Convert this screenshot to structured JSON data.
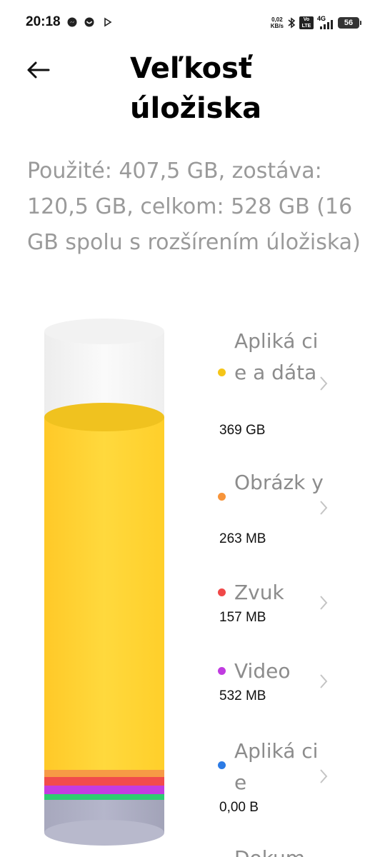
{
  "status_bar": {
    "time": "20:18",
    "net_speed_value": "0,02",
    "net_speed_unit": "KB/s",
    "volte_badge": "Vo LTE",
    "network_type": "4G",
    "battery": "56"
  },
  "header": {
    "title": "Veľkosť úložiska"
  },
  "summary": "Použité: 407,5 GB, zostáva: 120,5 GB, celkom: 528 GB (16 GB spolu s rozšírením úložiska)",
  "legend": [
    {
      "label": "Apliká cie a dáta",
      "size": "369 GB",
      "color": "#F5C518"
    },
    {
      "label": "Obrázk y",
      "size": "263 MB",
      "color": "#F7943A"
    },
    {
      "label": "Zvuk",
      "size": "157 MB",
      "color": "#F04848"
    },
    {
      "label": "Video",
      "size": "532 MB",
      "color": "#C03BE0"
    },
    {
      "label": "Apliká cie",
      "size": "0,00 B",
      "color": "#2C7BE5"
    },
    {
      "label": "Dokum",
      "size": "",
      "color": "#27C46B"
    }
  ],
  "colors": {
    "apps_data": "#FFD12E",
    "images": "#F7943A",
    "audio": "#F04848",
    "video": "#C03BE0",
    "documents": "#2ECC71",
    "system": "#A8A9BE",
    "free": "#F4F4F4"
  },
  "storage": {
    "used_gb": 407.5,
    "free_gb": 120.5,
    "total_gb": 528
  },
  "icons": {
    "back": "arrow-left-icon",
    "chevron": "chevron-right-icon"
  }
}
